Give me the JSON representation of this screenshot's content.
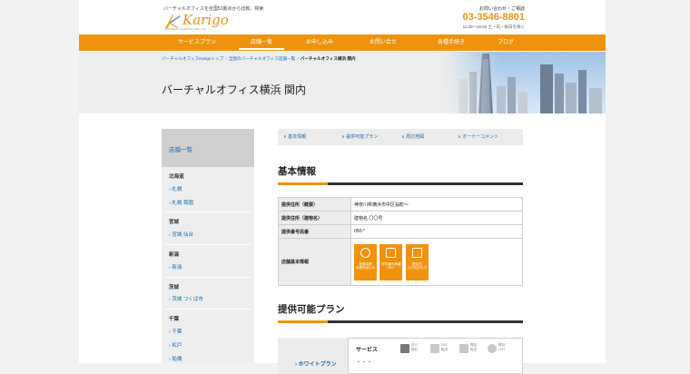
{
  "header": {
    "tagline": "バーチャルオフィスを全国51拠点から比較、検索",
    "logo_text": "Karigo",
    "logo_sub": "BUSINESS SUPPORT FOR YOU",
    "contact_label": "お問い合わせ・ご相談",
    "phone": "03-3546-8801",
    "hours": "11:00〜16:00 土・日・祝日を除く"
  },
  "nav": [
    "サービスプラン",
    "店舗一覧",
    "お申し込み",
    "お問い合せ",
    "各種手続き",
    "ブログ"
  ],
  "nav_active": "店舗一覧",
  "breadcrumb": [
    "バーチャルオフィスKarigoトップ",
    "全国のバーチャルオフィス店舗一覧",
    "バーチャルオフィス横浜 関内"
  ],
  "page_title": "バーチャルオフィス横浜 関内",
  "sidebar": {
    "header": "店舗一覧",
    "regions": [
      {
        "name": "北海道",
        "links": [
          "札幌",
          "札幌 菊園"
        ]
      },
      {
        "name": "宮城",
        "links": [
          "宮城 仙台"
        ]
      },
      {
        "name": "新潟",
        "links": [
          "新潟"
        ]
      },
      {
        "name": "茨城",
        "links": [
          "茨城 つくば市"
        ]
      },
      {
        "name": "千葉",
        "links": [
          "千葉",
          "松戸",
          "船橋"
        ]
      }
    ]
  },
  "tabs": [
    "基本情報",
    "提供可能プラン",
    "周辺地図",
    "オーナーコメント"
  ],
  "basic_info": {
    "title": "基本情報",
    "rows": [
      {
        "key": "提供住所（概要）",
        "value": "神奈川県横浜市中区翁町〜"
      },
      {
        "key": "提供住所（建物名）",
        "value": "建物名 〇〇号"
      },
      {
        "key": "提供番号局番",
        "value": "050-*"
      },
      {
        "key": "店舗基本情報",
        "value": ""
      }
    ],
    "badges": [
      {
        "icon": "clock-icon",
        "text": "営業時間\n特選気成のみ"
      },
      {
        "icon": "phone-icon",
        "text": "提供番号局番\n050-*"
      },
      {
        "icon": "calendar-icon",
        "text": "提供日\n土日祝日も可"
      }
    ]
  },
  "plans": {
    "title": "提供可能プラン",
    "plan_name": "ホワイトプラン",
    "service_label": "サービス",
    "dots": "・・・",
    "services": [
      {
        "icon": "seal-icon",
        "text": "法人\n登記"
      },
      {
        "icon": "fax-icon",
        "text": "FAX\n転送"
      },
      {
        "icon": "phone-forward-icon",
        "text": "電話\n転送"
      },
      {
        "icon": "person-icon",
        "text": "電話\n代行"
      }
    ]
  },
  "colors": {
    "accent": "#ef930e",
    "link": "#1a6bb5"
  }
}
